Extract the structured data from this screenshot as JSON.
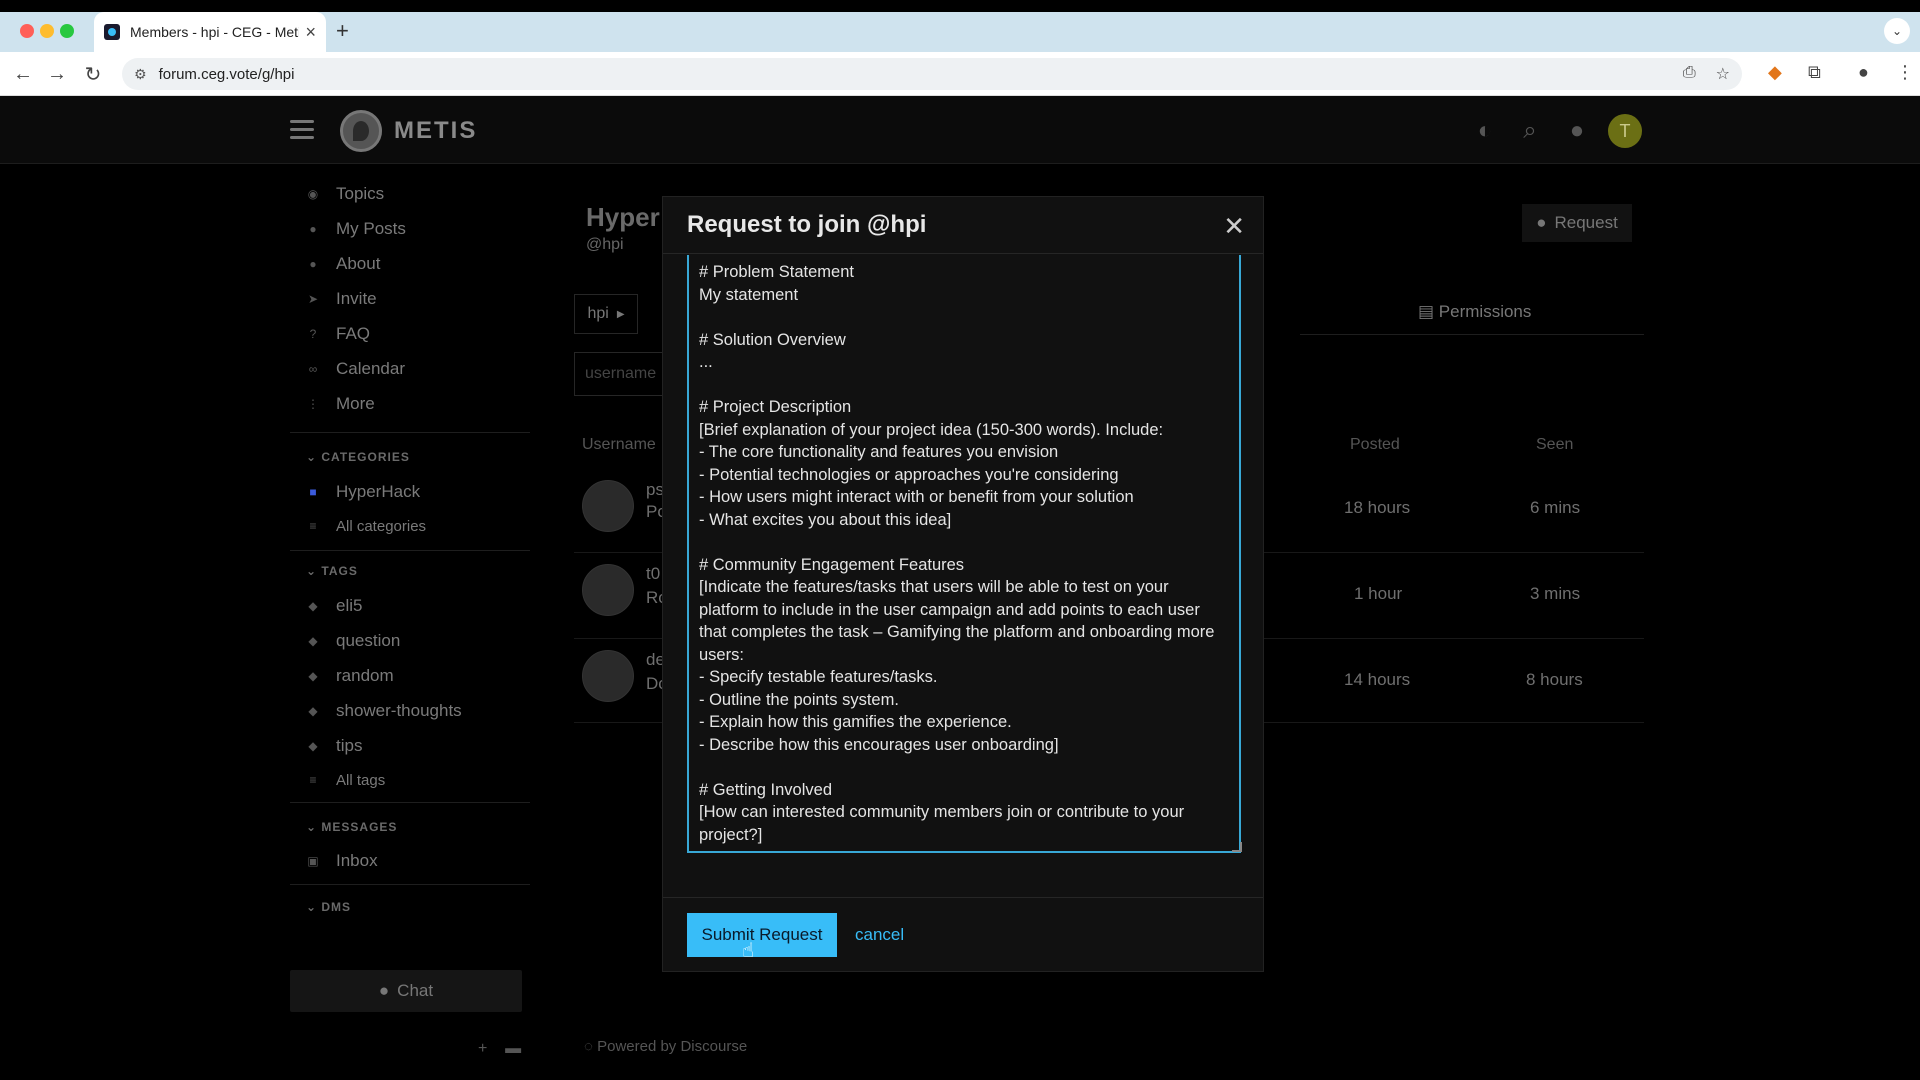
{
  "browser": {
    "tab_title": "Members - hpi - CEG - Metis",
    "url": "forum.ceg.vote/g/hpi",
    "traffic_colors": [
      "#ff5f57",
      "#febc2e",
      "#28c840"
    ]
  },
  "header": {
    "brand": "METIS",
    "avatar_letter": "T"
  },
  "sidebar": {
    "nav": [
      "Topics",
      "My Posts",
      "About",
      "Invite",
      "FAQ",
      "Calendar",
      "More"
    ],
    "categories_heading": "CATEGORIES",
    "categories": [
      "HyperHack",
      "All categories"
    ],
    "tags_heading": "TAGS",
    "tags": [
      "eli5",
      "question",
      "random",
      "shower-thoughts",
      "tips",
      "All tags"
    ],
    "messages_heading": "MESSAGES",
    "messages": [
      "Inbox"
    ],
    "dms_heading": "DMS",
    "chat_label": "Chat"
  },
  "group": {
    "title": "Hyper",
    "handle": "@hpi",
    "request_label": "Request",
    "permissions_label": "Permissions",
    "chip_label": "hpi",
    "username_placeholder": "username",
    "col_username": "Username",
    "col_posted": "Posted",
    "col_seen": "Seen",
    "rows": [
      {
        "name": "ps",
        "sub": "Po",
        "posted": "18 hours",
        "seen": "6 mins"
      },
      {
        "name": "t0",
        "sub": "Ro",
        "posted": "1 hour",
        "seen": "3 mins"
      },
      {
        "name": "de",
        "sub": "Do",
        "posted": "14 hours",
        "seen": "8 hours"
      }
    ]
  },
  "footer": {
    "powered": "Powered by Discourse"
  },
  "modal": {
    "title": "Request to join @hpi",
    "body": "# Problem Statement\nMy statement\n\n# Solution Overview\n...\n\n# Project Description\n[Brief explanation of your project idea (150-300 words). Include:\n- The core functionality and features you envision\n- Potential technologies or approaches you're considering\n- How users might interact with or benefit from your solution\n- What excites you about this idea]\n\n# Community Engagement Features\n[Indicate the features/tasks that users will be able to test on your platform to include in the user campaign and add points to each user that completes the task – Gamifying the platform and onboarding more users:\n- Specify testable features/tasks.\n- Outline the points system.\n- Explain how this gamifies the experience.\n- Describe how this encourages user onboarding]\n\n# Getting Involved\n[How can interested community members join or contribute to your project?]",
    "submit_label": "Submit Request",
    "cancel_label": "cancel"
  }
}
